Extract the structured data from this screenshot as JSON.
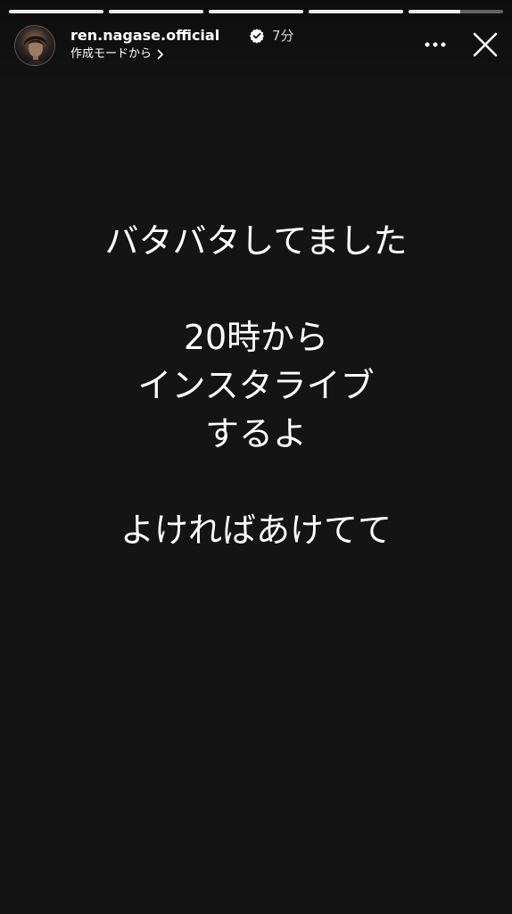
{
  "story": {
    "username": "ren.nagase.official",
    "verified": true,
    "time_ago": "7分",
    "subtitle": "作成モードから",
    "progress": {
      "segments": 5,
      "current_segment": 5,
      "current_fill": 0.55
    },
    "lines": [
      "バタバタしてました",
      "",
      "20時から",
      "インスタライブ",
      "するよ",
      "",
      "よければあけてて"
    ]
  },
  "icons": {
    "verified": "verified-badge-icon",
    "chevron": "chevron-right-icon",
    "more": "more-horizontal-icon",
    "close": "close-icon"
  },
  "colors": {
    "background": "#141414",
    "text": "#ffffff",
    "progress_track": "rgba(255,255,255,0.35)",
    "progress_fill": "rgba(255,255,255,0.88)"
  }
}
